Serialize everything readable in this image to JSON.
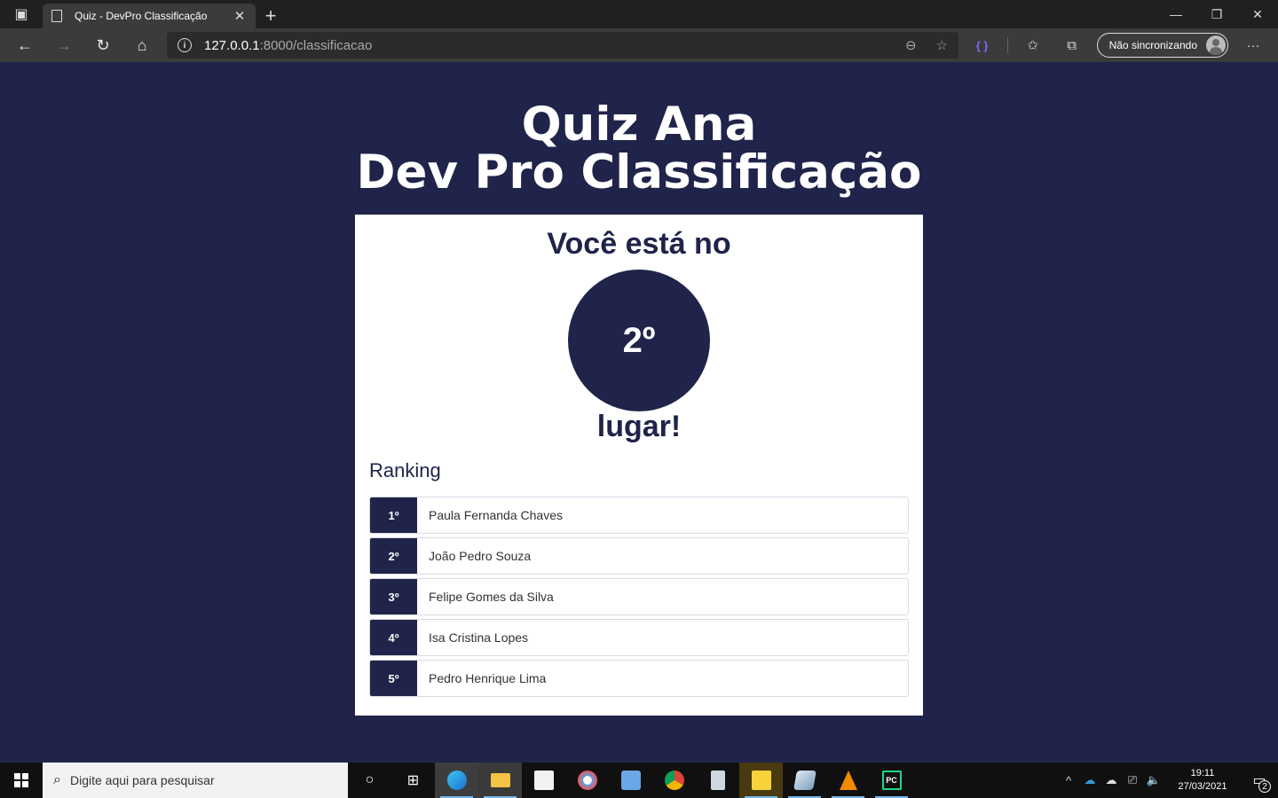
{
  "browser": {
    "tab_title": "Quiz - DevPro Classificação",
    "url_host": "127.0.0.1",
    "url_path": ":8000/classificacao",
    "sync_label": "Não sincronizando"
  },
  "page": {
    "title_line1": "Quiz Ana",
    "title_line2": "Dev Pro Classificação",
    "you_are": "Você está no",
    "position": "2º",
    "place_suffix": "lugar!",
    "ranking_title": "Ranking",
    "ranking": [
      {
        "position": "1º",
        "name": "Paula Fernanda Chaves"
      },
      {
        "position": "2º",
        "name": "João Pedro Souza"
      },
      {
        "position": "3º",
        "name": "Felipe Gomes da Silva"
      },
      {
        "position": "4º",
        "name": "Isa Cristina Lopes"
      },
      {
        "position": "5º",
        "name": "Pedro Henrique Lima"
      }
    ]
  },
  "taskbar": {
    "search_placeholder": "Digite aqui para pesquisar",
    "time": "19:11",
    "date": "27/03/2021",
    "notification_count": "2"
  },
  "colors": {
    "page_background": "#20244a",
    "card_background": "#ffffff",
    "accent": "#20244a"
  }
}
